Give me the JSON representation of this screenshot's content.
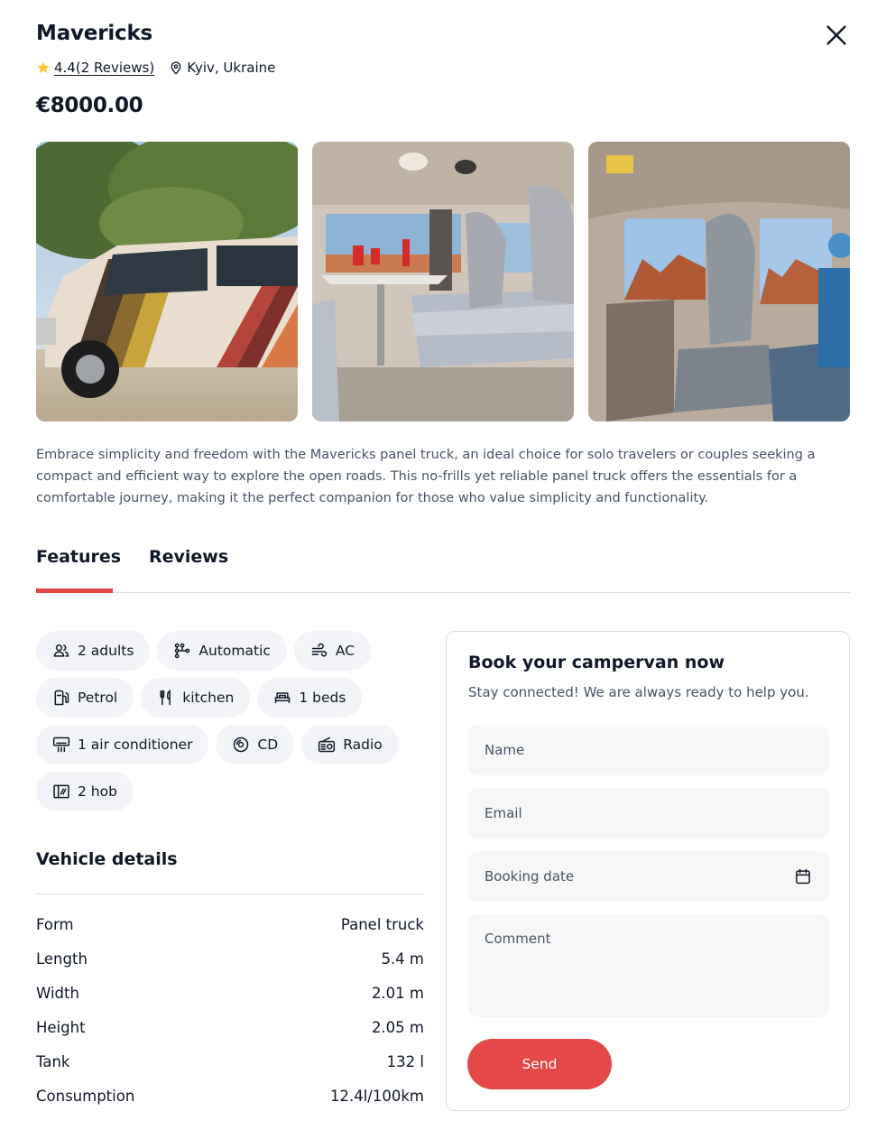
{
  "header": {
    "title": "Mavericks",
    "rating": "4.4(2 Reviews)",
    "location": "Kyiv, Ukraine",
    "price": "€8000.00"
  },
  "description": "Embrace simplicity and freedom with the Mavericks panel truck, an ideal choice for solo travelers or couples seeking a compact and efficient way to explore the open roads. This no-frills yet reliable panel truck offers the essentials for a comfortable journey, making it the perfect companion for those who value simplicity and functionality.",
  "tabs": [
    {
      "label": "Features",
      "active": true
    },
    {
      "label": "Reviews",
      "active": false
    }
  ],
  "features": [
    {
      "label": "2 adults",
      "icon": "users-icon"
    },
    {
      "label": "Automatic",
      "icon": "transmission-icon"
    },
    {
      "label": "AC",
      "icon": "wind-icon"
    },
    {
      "label": "Petrol",
      "icon": "fuel-icon"
    },
    {
      "label": "kitchen",
      "icon": "cutlery-icon"
    },
    {
      "label": "1 beds",
      "icon": "bed-icon"
    },
    {
      "label": "1 air conditioner",
      "icon": "air-conditioner-icon"
    },
    {
      "label": "CD",
      "icon": "cd-icon"
    },
    {
      "label": "Radio",
      "icon": "radio-icon"
    },
    {
      "label": "2 hob",
      "icon": "hob-icon"
    }
  ],
  "vehicle_details": {
    "title": "Vehicle details",
    "rows": [
      {
        "label": "Form",
        "value": "Panel truck"
      },
      {
        "label": "Length",
        "value": "5.4 m"
      },
      {
        "label": "Width",
        "value": "2.01 m"
      },
      {
        "label": "Height",
        "value": "2.05 m"
      },
      {
        "label": "Tank",
        "value": "132 l"
      },
      {
        "label": "Consumption",
        "value": "12.4l/100km"
      }
    ]
  },
  "booking": {
    "title": "Book your campervan now",
    "subtitle": "Stay connected! We are always ready to help you.",
    "name_placeholder": "Name",
    "email_placeholder": "Email",
    "date_placeholder": "Booking date",
    "comment_placeholder": "Comment",
    "send_label": "Send"
  },
  "colors": {
    "accent": "#E44848",
    "star": "#FFC531",
    "text": "#101828",
    "muted": "#475467",
    "chip_bg": "#F2F4F7",
    "input_bg": "#F7F7F7"
  }
}
